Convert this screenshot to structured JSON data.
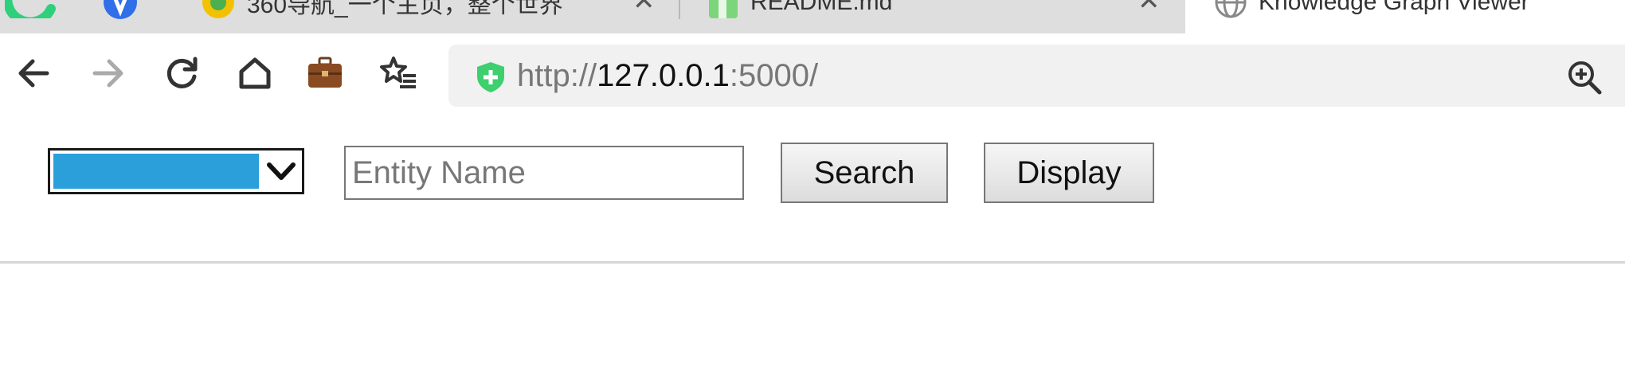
{
  "tabs": [
    {
      "title": "",
      "icon": "360-browser-logo-icon"
    },
    {
      "title": "",
      "icon": "blue-app-icon"
    },
    {
      "title": "360导航_一个主页，整个世界",
      "icon": "360-nav-icon",
      "close": "✕"
    },
    {
      "title": "README.md",
      "icon": "document-icon",
      "close": "✕"
    },
    {
      "title": "Knowledge Graph Viewer",
      "icon": "globe-icon",
      "active": true
    }
  ],
  "address": {
    "scheme": "http://",
    "host": "127.0.0.1",
    "rest": ":5000/"
  },
  "controls": {
    "select_value": "",
    "entity_placeholder": "Entity Name",
    "entity_value": "",
    "search_label": "Search",
    "display_label": "Display"
  },
  "colors": {
    "select_highlight": "#2a9fd9",
    "shield_green": "#3ecf6e",
    "tab_strip": "#dedede"
  }
}
